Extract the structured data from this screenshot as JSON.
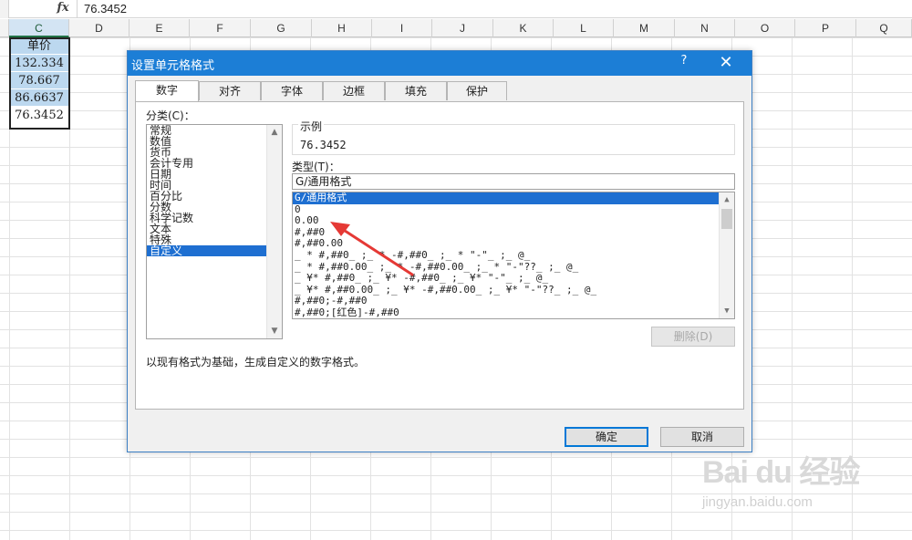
{
  "formula_bar": {
    "fx_label": "fx",
    "value": "76.3452"
  },
  "columns": [
    "C",
    "D",
    "E",
    "F",
    "G",
    "H",
    "I",
    "J",
    "K",
    "L",
    "M",
    "N",
    "O",
    "P",
    "Q"
  ],
  "column_c_cells": [
    "单价",
    "132.334",
    "78.667",
    "86.6637",
    "76.3452"
  ],
  "dialog": {
    "title": "设置单元格格式",
    "help": "?",
    "close": "✕",
    "tabs": [
      "数字",
      "对齐",
      "字体",
      "边框",
      "填充",
      "保护"
    ],
    "category_label": "分类(C)：",
    "categories": [
      "常规",
      "数值",
      "货币",
      "会计专用",
      "日期",
      "时间",
      "百分比",
      "分数",
      "科学记数",
      "文本",
      "特殊",
      "自定义"
    ],
    "selected_category": "自定义",
    "sample_label": "示例",
    "sample_value": "76.3452",
    "type_label": "类型(T)：",
    "type_value": "G/通用格式",
    "type_items": [
      "G/通用格式",
      "0",
      "0.00",
      "#,##0",
      "#,##0.00",
      "_ * #,##0_ ;_ * -#,##0_ ;_ * \"-\"_ ;_ @_",
      "_ * #,##0.00_ ;_ * -#,##0.00_ ;_ * \"-\"??_ ;_ @_",
      "_ ¥* #,##0_ ;_ ¥* -#,##0_ ;_ ¥* \"-\"_ ;_ @_",
      "_ ¥* #,##0.00_ ;_ ¥* -#,##0.00_ ;_ ¥* \"-\"??_ ;_ @_",
      "#,##0;-#,##0",
      "#,##0;[红色]-#,##0"
    ],
    "delete_button": "删除(D)",
    "description": "以现有格式为基础，生成自定义的数字格式。",
    "ok_button": "确定",
    "cancel_button": "取消"
  },
  "watermark": {
    "text": "Bai du 经验",
    "sub": "jingyan.baidu.com"
  },
  "colors": {
    "title_bar": "#1c7ed6",
    "selection": "#1e6fd1",
    "arrow": "#e53935",
    "cell_highlight": "#bcd8ef"
  }
}
